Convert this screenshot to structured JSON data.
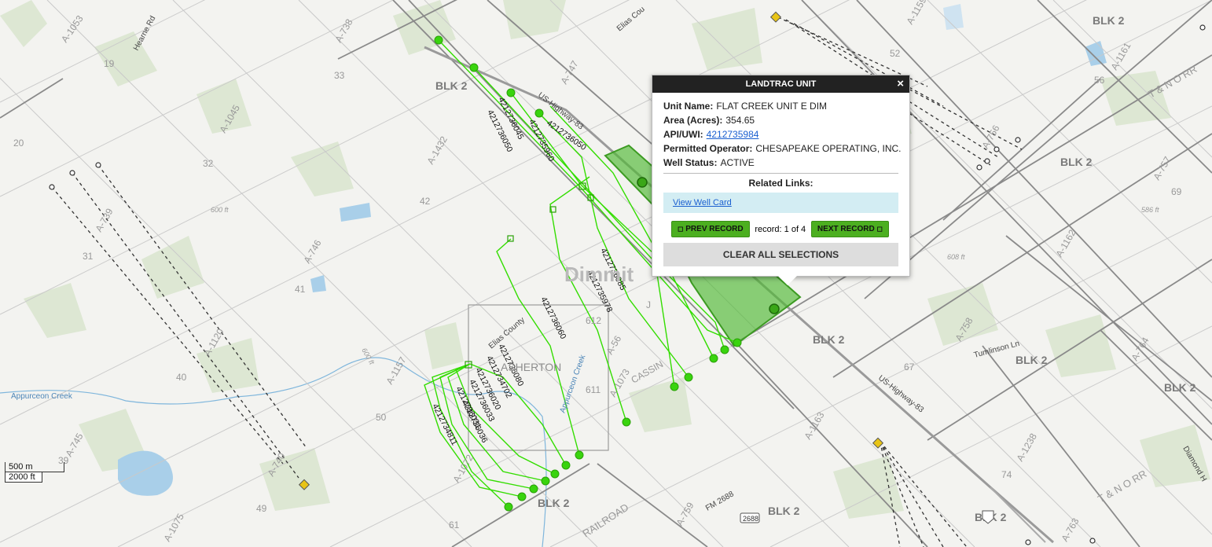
{
  "popup": {
    "title": "LANDTRAC UNIT",
    "close_glyph": "×",
    "unit_name_label": "Unit Name:",
    "unit_name": "FLAT CREEK UNIT E DIM",
    "area_label": "Area (Acres):",
    "area": "354.65",
    "api_label": "API/UWI:",
    "api": "4212735984",
    "operator_label": "Permitted Operator:",
    "operator": "CHESAPEAKE OPERATING, INC.",
    "status_label": "Well Status:",
    "status": "ACTIVE",
    "related_title": "Related Links:",
    "well_card_link": "View Well Card",
    "prev_label": "PREV RECORD",
    "record_text": "record: 1 of 4",
    "next_label": "NEXT RECORD",
    "clear_label": "CLEAR ALL SELECTIONS"
  },
  "scale": {
    "metric": "500 m",
    "imperial": "2000 ft"
  },
  "map_labels": {
    "county": "Dimmit",
    "town": "ASHERTON",
    "blk2": "BLK 2",
    "highway": "US-Highway-83",
    "fm": "FM 2688",
    "shield": "2688",
    "railroad": "RAILROAD",
    "creek": "Appurceon Creek",
    "tumlinson": "Tumlinson Ln",
    "hearne": "Hearne Rd",
    "tnorr": "T & N O RR",
    "diamond": "Diamond H",
    "cassin": "CASSIN",
    "elias": "Elias County",
    "elias2": "Elias Cou",
    "ft600": "600 ft",
    "ft608": "608 ft",
    "ft586": "586 ft"
  },
  "wells": [
    "4212736045",
    "4212736050",
    "4212735960",
    "4212736050",
    "4212736085",
    "4212735978",
    "4212736060",
    "4212736080",
    "4212734702",
    "4212736020",
    "4212736033",
    "4212736031",
    "4212736036",
    "4212734811"
  ],
  "colors": {
    "well_line": "#33dd00",
    "unit_fill": "#4fb833",
    "popup_header": "#222222",
    "link": "#1a5fd0"
  }
}
